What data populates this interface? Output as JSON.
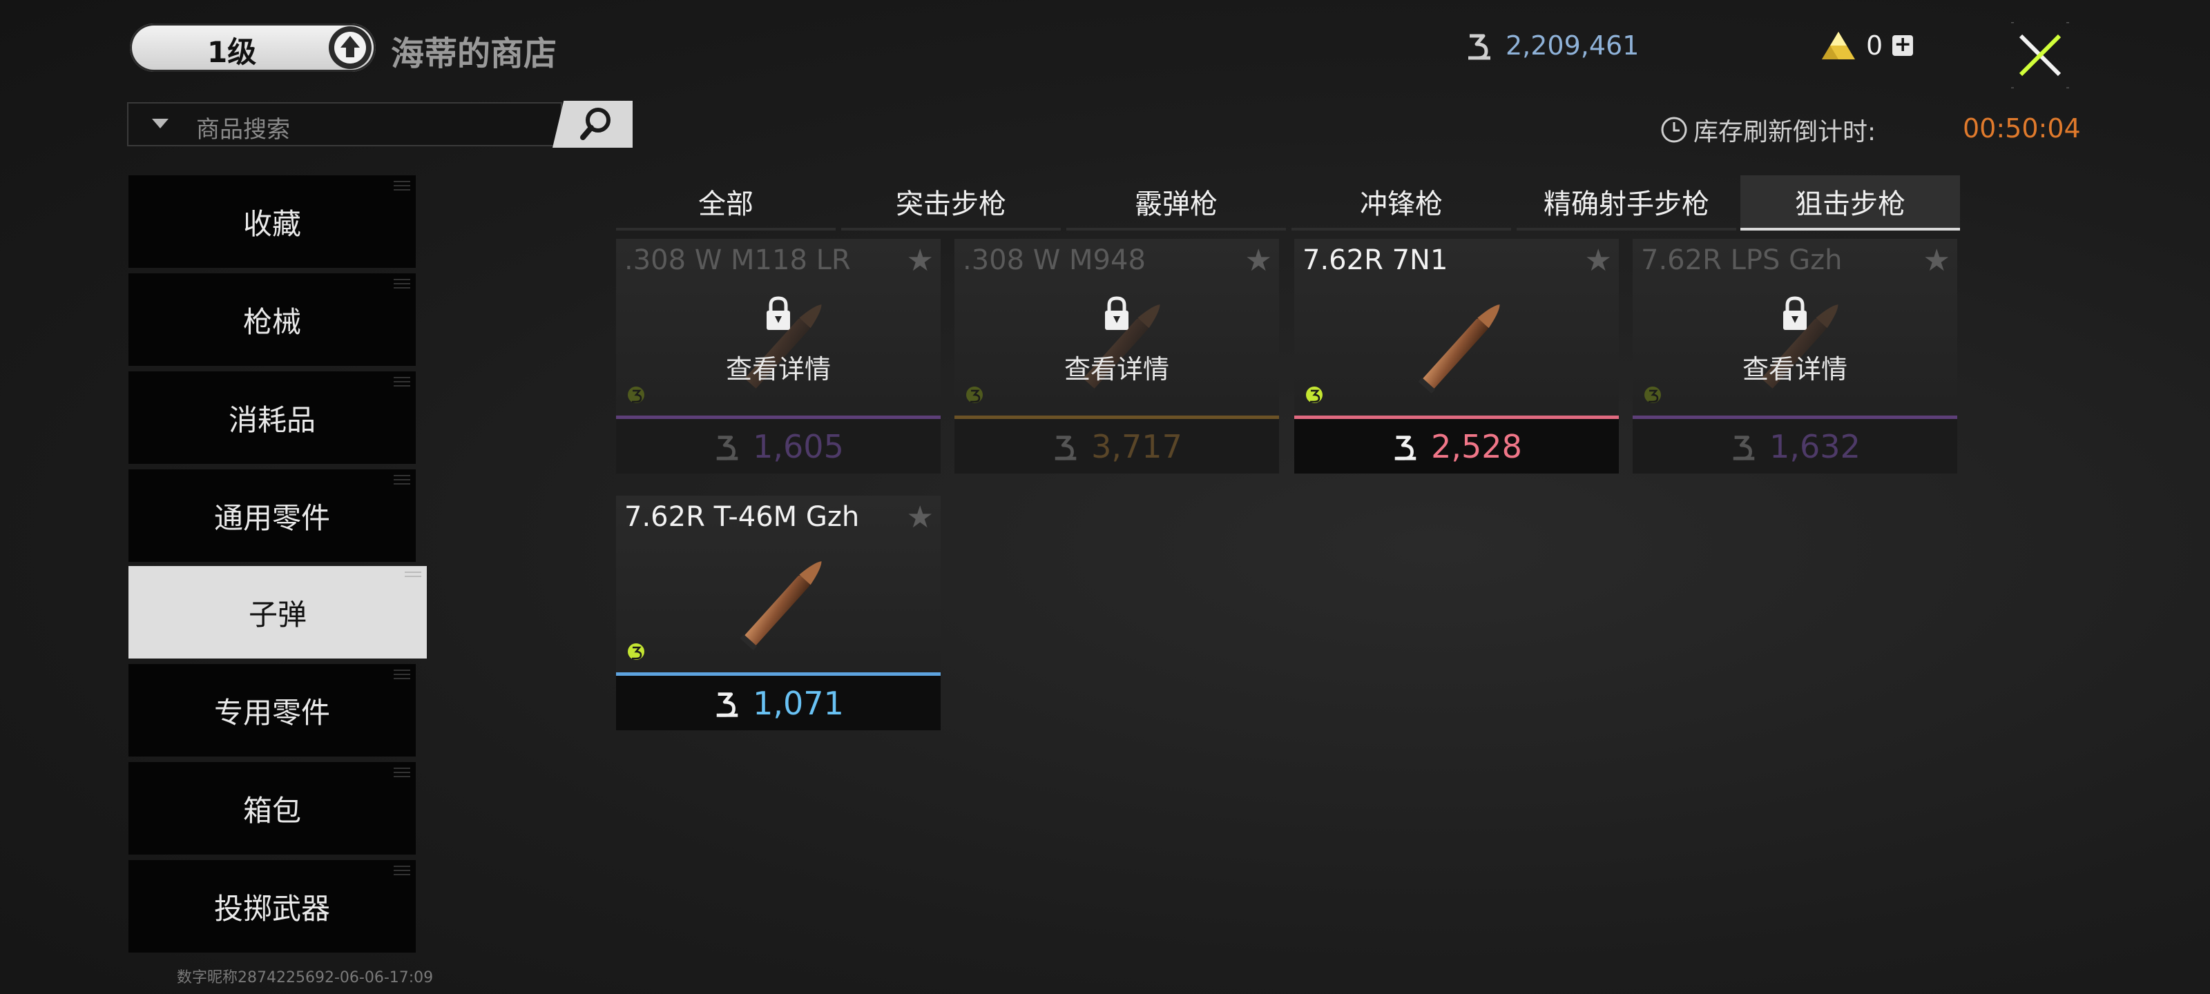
{
  "header": {
    "level_label": "1级",
    "shop_title": "海蒂的商店",
    "money": "2,209,461",
    "gold": "0",
    "gold_plus": "+",
    "money_icon": "koen-currency-icon",
    "gold_icon": "gold-pyramid-icon",
    "close_icon": "close-x-icon"
  },
  "search": {
    "placeholder": "商品搜索"
  },
  "refresh": {
    "label": "库存刷新倒计时:",
    "timer": "00:50:04"
  },
  "sidebar": {
    "items": [
      {
        "label": "收藏"
      },
      {
        "label": "枪械"
      },
      {
        "label": "消耗品"
      },
      {
        "label": "通用零件"
      },
      {
        "label": "子弹",
        "active": true
      },
      {
        "label": "专用零件"
      },
      {
        "label": "箱包"
      },
      {
        "label": "投掷武器"
      }
    ]
  },
  "tabs": [
    {
      "label": "全部"
    },
    {
      "label": "突击步枪"
    },
    {
      "label": "霰弹枪"
    },
    {
      "label": "冲锋枪"
    },
    {
      "label": "精确射手步枪"
    },
    {
      "label": "狙击步枪",
      "active": true
    }
  ],
  "items": [
    {
      "name": ".308 W M118 LR",
      "price": "1,605",
      "locked": true,
      "details": "查看详情",
      "rarity_color": "#5d3f78",
      "price_color": "#4e3a68"
    },
    {
      "name": ".308 W M948",
      "price": "3,717",
      "locked": true,
      "details": "查看详情",
      "rarity_color": "#6b5226",
      "price_color": "#5a4628"
    },
    {
      "name": "7.62R 7N1",
      "price": "2,528",
      "locked": false,
      "rarity_color": "#e06a80",
      "price_color": "#f07688"
    },
    {
      "name": "7.62R LPS Gzh",
      "price": "1,632",
      "locked": true,
      "details": "查看详情",
      "rarity_color": "#5d3f78",
      "price_color": "#4e3a68"
    },
    {
      "name": "7.62R T-46M Gzh",
      "price": "1,071",
      "locked": false,
      "rarity_color": "#5ea4e0",
      "price_color": "#69c2f4"
    }
  ],
  "watermark": "数字昵称2874225692-06-06-17:09",
  "colors": {
    "accent_orange": "#e07a2c",
    "money_blue": "#8fb2d8",
    "badge_green": "#c4e632"
  }
}
